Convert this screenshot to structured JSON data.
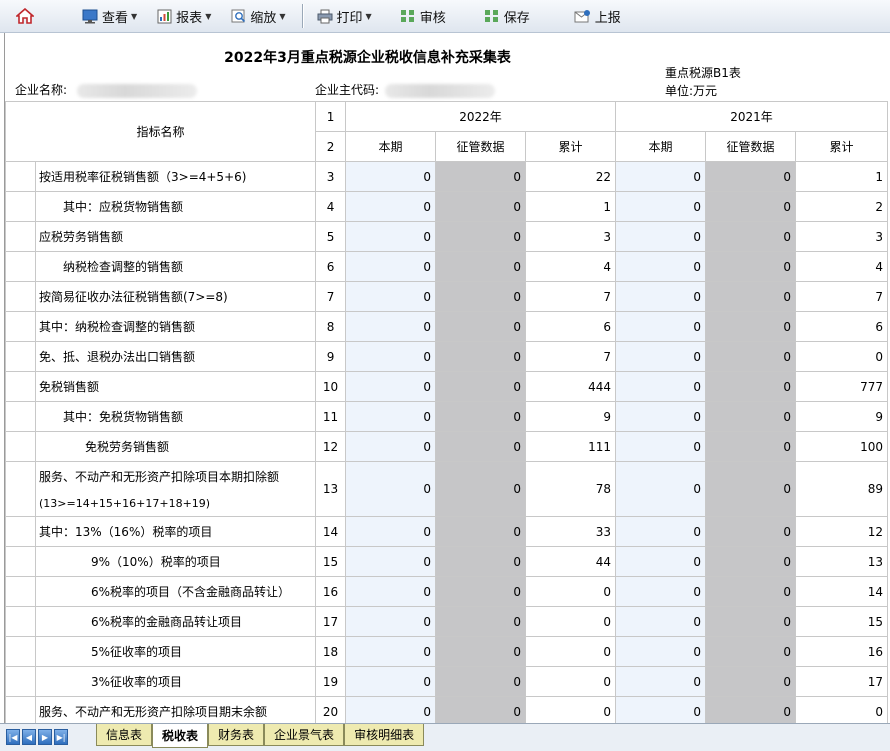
{
  "toolbar": {
    "view": "查看",
    "report": "报表",
    "zoom": "缩放",
    "print": "打印",
    "audit": "审核",
    "save": "保存",
    "upload": "上报"
  },
  "header": {
    "title": "2022年3月重点税源企业税收信息补充采集表",
    "company_name_label": "企业名称:",
    "company_code_label": "企业主代码:",
    "form_code": "重点税源B1表",
    "unit": "单位:万元"
  },
  "table": {
    "col_indicator": "指标名称",
    "line_1": "1",
    "line_2": "2",
    "year_current": "2022年",
    "year_prior": "2021年",
    "sub_current": "本期",
    "sub_supervision": "征管数据",
    "sub_cumulative": "累计",
    "rows": [
      {
        "name": "按适用税率征税销售额（3>=4+5+6)",
        "indent": 0,
        "ln": "3",
        "v": [
          "0",
          "0",
          "22",
          "0",
          "0",
          "1"
        ]
      },
      {
        "name": "其中：应税货物销售额",
        "indent": 1,
        "ln": "4",
        "v": [
          "0",
          "0",
          "1",
          "0",
          "0",
          "2"
        ]
      },
      {
        "name": "应税劳务销售额",
        "indent": 0,
        "ln": "5",
        "v": [
          "0",
          "0",
          "3",
          "0",
          "0",
          "3"
        ]
      },
      {
        "name": "纳税检查调整的销售额",
        "indent": 1,
        "ln": "6",
        "v": [
          "0",
          "0",
          "4",
          "0",
          "0",
          "4"
        ]
      },
      {
        "name": "按简易征收办法征税销售额(7>=8)",
        "indent": 0,
        "ln": "7",
        "v": [
          "0",
          "0",
          "7",
          "0",
          "0",
          "7"
        ]
      },
      {
        "name": "其中：纳税检查调整的销售额",
        "indent": 0,
        "ln": "8",
        "v": [
          "0",
          "0",
          "6",
          "0",
          "0",
          "6"
        ]
      },
      {
        "name": "免、抵、退税办法出口销售额",
        "indent": 0,
        "ln": "9",
        "v": [
          "0",
          "0",
          "7",
          "0",
          "0",
          "0"
        ]
      },
      {
        "name": "免税销售额",
        "indent": 0,
        "ln": "10",
        "v": [
          "0",
          "0",
          "444",
          "0",
          "0",
          "777"
        ]
      },
      {
        "name": "其中：免税货物销售额",
        "indent": 1,
        "ln": "11",
        "v": [
          "0",
          "0",
          "9",
          "0",
          "0",
          "9"
        ]
      },
      {
        "name": "免税劳务销售额",
        "indent": 2,
        "ln": "12",
        "v": [
          "0",
          "0",
          "111",
          "0",
          "0",
          "100"
        ]
      },
      {
        "name": "服务、不动产和无形资产扣除项目本期扣除额",
        "name2": "(13>=14+15+16+17+18+19)",
        "indent": 0,
        "ln": "13",
        "tall": true,
        "v": [
          "0",
          "0",
          "78",
          "0",
          "0",
          "89"
        ]
      },
      {
        "name": "其中：13%（16%）税率的项目",
        "indent": 0,
        "ln": "14",
        "v": [
          "0",
          "0",
          "33",
          "0",
          "0",
          "12"
        ]
      },
      {
        "name": "9%（10%）税率的项目",
        "indent": 3,
        "ln": "15",
        "v": [
          "0",
          "0",
          "44",
          "0",
          "0",
          "13"
        ]
      },
      {
        "name": "6%税率的项目（不含金融商品转让）",
        "indent": 3,
        "ln": "16",
        "v": [
          "0",
          "0",
          "0",
          "0",
          "0",
          "14"
        ]
      },
      {
        "name": "6%税率的金融商品转让项目",
        "indent": 3,
        "ln": "17",
        "v": [
          "0",
          "0",
          "0",
          "0",
          "0",
          "15"
        ]
      },
      {
        "name": "5%征收率的项目",
        "indent": 3,
        "ln": "18",
        "v": [
          "0",
          "0",
          "0",
          "0",
          "0",
          "16"
        ]
      },
      {
        "name": "3%征收率的项目",
        "indent": 3,
        "ln": "19",
        "v": [
          "0",
          "0",
          "0",
          "0",
          "0",
          "17"
        ]
      },
      {
        "name": "服务、不动产和无形资产扣除项目期末余额",
        "indent": 0,
        "ln": "20",
        "v": [
          "0",
          "0",
          "0",
          "0",
          "0",
          "0"
        ]
      }
    ]
  },
  "tabs": [
    "信息表",
    "税收表",
    "财务表",
    "企业景气表",
    "审核明细表"
  ],
  "active_tab": "税收表",
  "colors": {
    "input_cell": "#eef4fc",
    "locked_cell": "#c6c6c8",
    "tab_bg": "#eeeab0"
  },
  "icons": [
    "home-icon",
    "monitor-icon",
    "report-icon",
    "zoom-icon",
    "printer-icon",
    "audit-icon",
    "save-icon",
    "upload-icon"
  ]
}
